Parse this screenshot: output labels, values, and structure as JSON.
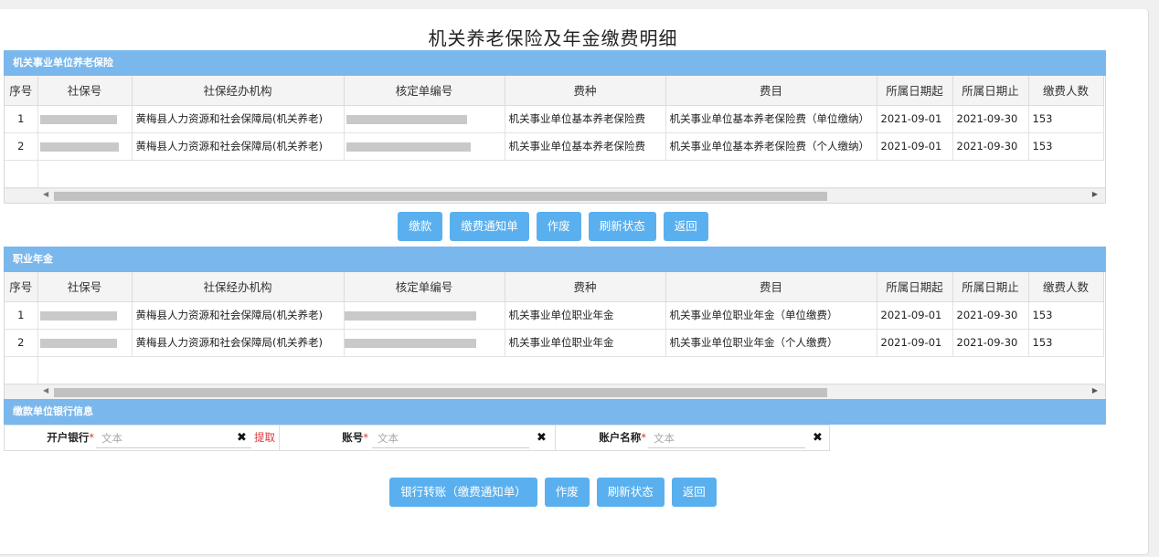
{
  "page_title": "机关养老保险及年金缴费明细",
  "columns": [
    "序号",
    "社保号",
    "社保经办机构",
    "核定单编号",
    "费种",
    "费目",
    "所属日期起",
    "所属日期止",
    "缴费人数"
  ],
  "section1": {
    "title": "机关事业单位养老保险",
    "rows": [
      {
        "seq": "1",
        "agency": "黄梅县人力资源和社会保障局(机关养老)",
        "fee_type": "机关事业单位基本养老保险费",
        "fee_item": "机关事业单位基本养老保险费（单位缴纳）",
        "date_from": "2021-09-01",
        "date_to": "2021-09-30",
        "count": "153"
      },
      {
        "seq": "2",
        "agency": "黄梅县人力资源和社会保障局(机关养老)",
        "fee_type": "机关事业单位基本养老保险费",
        "fee_item": "机关事业单位基本养老保险费（个人缴纳）",
        "date_from": "2021-09-01",
        "date_to": "2021-09-30",
        "count": "153"
      }
    ],
    "buttons": [
      "缴款",
      "缴费通知单",
      "作废",
      "刷新状态",
      "返回"
    ]
  },
  "section2": {
    "title": "职业年金",
    "rows": [
      {
        "seq": "1",
        "agency": "黄梅县人力资源和社会保障局(机关养老)",
        "fee_type": "机关事业单位职业年金",
        "fee_item": "机关事业单位职业年金（单位缴费）",
        "date_from": "2021-09-01",
        "date_to": "2021-09-30",
        "count": "153"
      },
      {
        "seq": "2",
        "agency": "黄梅县人力资源和社会保障局(机关养老)",
        "fee_type": "机关事业单位职业年金",
        "fee_item": "机关事业单位职业年金（个人缴费）",
        "date_from": "2021-09-01",
        "date_to": "2021-09-30",
        "count": "153"
      }
    ]
  },
  "bank": {
    "title": "缴款单位银行信息",
    "bank_label": "开户银行",
    "account_label": "账号",
    "name_label": "账户名称",
    "required_mark": "*",
    "placeholder": "文本",
    "fetch_label": "提取",
    "clear_glyph": "✖"
  },
  "bottom_buttons": [
    "银行转账（缴费通知单）",
    "作废",
    "刷新状态",
    "返回"
  ],
  "colors": {
    "header_blue": "#7ab7ec",
    "button_blue": "#5ab0ef",
    "required_red": "#e03030"
  }
}
